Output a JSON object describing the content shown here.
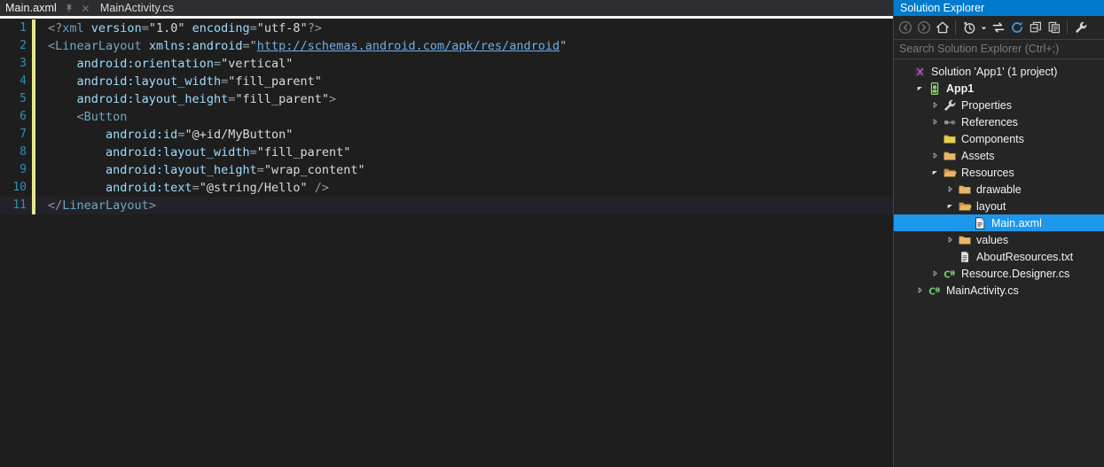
{
  "editor": {
    "tabs": [
      {
        "label": "Main.axml",
        "active": true,
        "icons": [
          "pin-icon",
          "close-icon"
        ]
      },
      {
        "label": "MainActivity.cs",
        "active": false,
        "icons": []
      }
    ],
    "language": "xml",
    "filename": "Main.axml",
    "current_line": 11,
    "lines": [
      {
        "number": "1",
        "changed": true,
        "current": false,
        "indent": 0,
        "tokens": [
          {
            "t": "<?",
            "c": "tk-punct"
          },
          {
            "t": "xml",
            "c": "tk-pi"
          },
          {
            "t": " ",
            "c": "tk-val"
          },
          {
            "t": "version",
            "c": "tk-attr"
          },
          {
            "t": "=",
            "c": "tk-eq"
          },
          {
            "t": "\"1.0\"",
            "c": "tk-val"
          },
          {
            "t": " ",
            "c": "tk-val"
          },
          {
            "t": "encoding",
            "c": "tk-attr"
          },
          {
            "t": "=",
            "c": "tk-eq"
          },
          {
            "t": "\"utf-8\"",
            "c": "tk-val"
          },
          {
            "t": "?>",
            "c": "tk-punct"
          }
        ]
      },
      {
        "number": "2",
        "changed": true,
        "current": false,
        "indent": 0,
        "tokens": [
          {
            "t": "<",
            "c": "tk-punct"
          },
          {
            "t": "LinearLayout",
            "c": "tk-tag"
          },
          {
            "t": " ",
            "c": "tk-val"
          },
          {
            "t": "xmlns:android",
            "c": "tk-attr"
          },
          {
            "t": "=",
            "c": "tk-eq"
          },
          {
            "t": "\"",
            "c": "tk-quote"
          },
          {
            "t": "http://schemas.android.com/apk/res/android",
            "c": "tk-link"
          },
          {
            "t": "\"",
            "c": "tk-quote"
          }
        ]
      },
      {
        "number": "3",
        "changed": true,
        "current": false,
        "indent": 4,
        "tokens": [
          {
            "t": "android:orientation",
            "c": "tk-attr"
          },
          {
            "t": "=",
            "c": "tk-eq"
          },
          {
            "t": "\"vertical\"",
            "c": "tk-val"
          }
        ]
      },
      {
        "number": "4",
        "changed": true,
        "current": false,
        "indent": 4,
        "tokens": [
          {
            "t": "android:layout_width",
            "c": "tk-attr"
          },
          {
            "t": "=",
            "c": "tk-eq"
          },
          {
            "t": "\"fill_parent\"",
            "c": "tk-val"
          }
        ]
      },
      {
        "number": "5",
        "changed": true,
        "current": false,
        "indent": 4,
        "tokens": [
          {
            "t": "android:layout_height",
            "c": "tk-attr"
          },
          {
            "t": "=",
            "c": "tk-eq"
          },
          {
            "t": "\"fill_parent\"",
            "c": "tk-val"
          },
          {
            "t": ">",
            "c": "tk-punct"
          }
        ]
      },
      {
        "number": "6",
        "changed": true,
        "current": false,
        "indent": 4,
        "tokens": [
          {
            "t": "<",
            "c": "tk-punct"
          },
          {
            "t": "Button",
            "c": "tk-tag"
          }
        ]
      },
      {
        "number": "7",
        "changed": true,
        "current": false,
        "indent": 8,
        "tokens": [
          {
            "t": "android:id",
            "c": "tk-attr"
          },
          {
            "t": "=",
            "c": "tk-eq"
          },
          {
            "t": "\"@+id/MyButton\"",
            "c": "tk-val"
          }
        ]
      },
      {
        "number": "8",
        "changed": true,
        "current": false,
        "indent": 8,
        "tokens": [
          {
            "t": "android:layout_width",
            "c": "tk-attr"
          },
          {
            "t": "=",
            "c": "tk-eq"
          },
          {
            "t": "\"fill_parent\"",
            "c": "tk-val"
          }
        ]
      },
      {
        "number": "9",
        "changed": true,
        "current": false,
        "indent": 8,
        "tokens": [
          {
            "t": "android:layout_height",
            "c": "tk-attr"
          },
          {
            "t": "=",
            "c": "tk-eq"
          },
          {
            "t": "\"wrap_content\"",
            "c": "tk-val"
          }
        ]
      },
      {
        "number": "10",
        "changed": true,
        "current": false,
        "indent": 8,
        "tokens": [
          {
            "t": "android:text",
            "c": "tk-attr"
          },
          {
            "t": "=",
            "c": "tk-eq"
          },
          {
            "t": "\"@string/Hello\"",
            "c": "tk-val"
          },
          {
            "t": " />",
            "c": "tk-punct"
          }
        ]
      },
      {
        "number": "11",
        "changed": true,
        "current": true,
        "indent": 0,
        "tokens": [
          {
            "t": "</",
            "c": "tk-punct"
          },
          {
            "t": "LinearLayout",
            "c": "tk-tag"
          },
          {
            "t": ">",
            "c": "tk-punct"
          }
        ]
      }
    ]
  },
  "solution_explorer": {
    "title": "Solution Explorer",
    "title_bg": "#007acc",
    "selection_bg": "#1c97ea",
    "search": {
      "placeholder": "Search Solution Explorer (Ctrl+;)",
      "value": ""
    },
    "toolbar": [
      {
        "name": "back-icon",
        "title": "Back"
      },
      {
        "name": "forward-icon",
        "title": "Forward"
      },
      {
        "name": "home-icon",
        "title": "Home"
      },
      {
        "name": "pending-changes-icon",
        "title": "Pending Changes"
      },
      {
        "name": "chevron-down-icon",
        "title": "More"
      },
      {
        "name": "sync-with-editor-icon",
        "title": "Sync with Active Document"
      },
      {
        "name": "refresh-icon",
        "title": "Refresh"
      },
      {
        "name": "collapse-all-icon",
        "title": "Collapse All"
      },
      {
        "name": "show-all-files-icon",
        "title": "Show All Files"
      },
      {
        "name": "properties-wrench-icon",
        "title": "Properties"
      }
    ],
    "tree": [
      {
        "label": "Solution 'App1' (1 project)",
        "indent": 0,
        "twisty": "none",
        "icon": "solution-icon",
        "bold": false,
        "selected": false
      },
      {
        "label": "App1",
        "indent": 1,
        "twisty": "expanded",
        "icon": "android-project-icon",
        "bold": true,
        "selected": false
      },
      {
        "label": "Properties",
        "indent": 2,
        "twisty": "collapsed",
        "icon": "wrench-icon",
        "bold": false,
        "selected": false
      },
      {
        "label": "References",
        "indent": 2,
        "twisty": "collapsed",
        "icon": "references-icon",
        "bold": false,
        "selected": false
      },
      {
        "label": "Components",
        "indent": 2,
        "twisty": "none",
        "icon": "folder-yellow-icon",
        "bold": false,
        "selected": false
      },
      {
        "label": "Assets",
        "indent": 2,
        "twisty": "collapsed",
        "icon": "folder-icon",
        "bold": false,
        "selected": false
      },
      {
        "label": "Resources",
        "indent": 2,
        "twisty": "expanded",
        "icon": "folder-open-icon",
        "bold": false,
        "selected": false
      },
      {
        "label": "drawable",
        "indent": 3,
        "twisty": "collapsed",
        "icon": "folder-icon",
        "bold": false,
        "selected": false
      },
      {
        "label": "layout",
        "indent": 3,
        "twisty": "expanded",
        "icon": "folder-open-icon",
        "bold": false,
        "selected": false
      },
      {
        "label": "Main.axml",
        "indent": 4,
        "twisty": "none",
        "icon": "xml-file-icon",
        "bold": false,
        "selected": true
      },
      {
        "label": "values",
        "indent": 3,
        "twisty": "collapsed",
        "icon": "folder-icon",
        "bold": false,
        "selected": false
      },
      {
        "label": "AboutResources.txt",
        "indent": 3,
        "twisty": "none",
        "icon": "text-file-icon",
        "bold": false,
        "selected": false
      },
      {
        "label": "Resource.Designer.cs",
        "indent": 2,
        "twisty": "collapsed",
        "icon": "csharp-file-icon",
        "bold": false,
        "selected": false
      },
      {
        "label": "MainActivity.cs",
        "indent": 1,
        "twisty": "collapsed",
        "icon": "csharp-file-icon",
        "bold": false,
        "selected": false
      }
    ]
  }
}
